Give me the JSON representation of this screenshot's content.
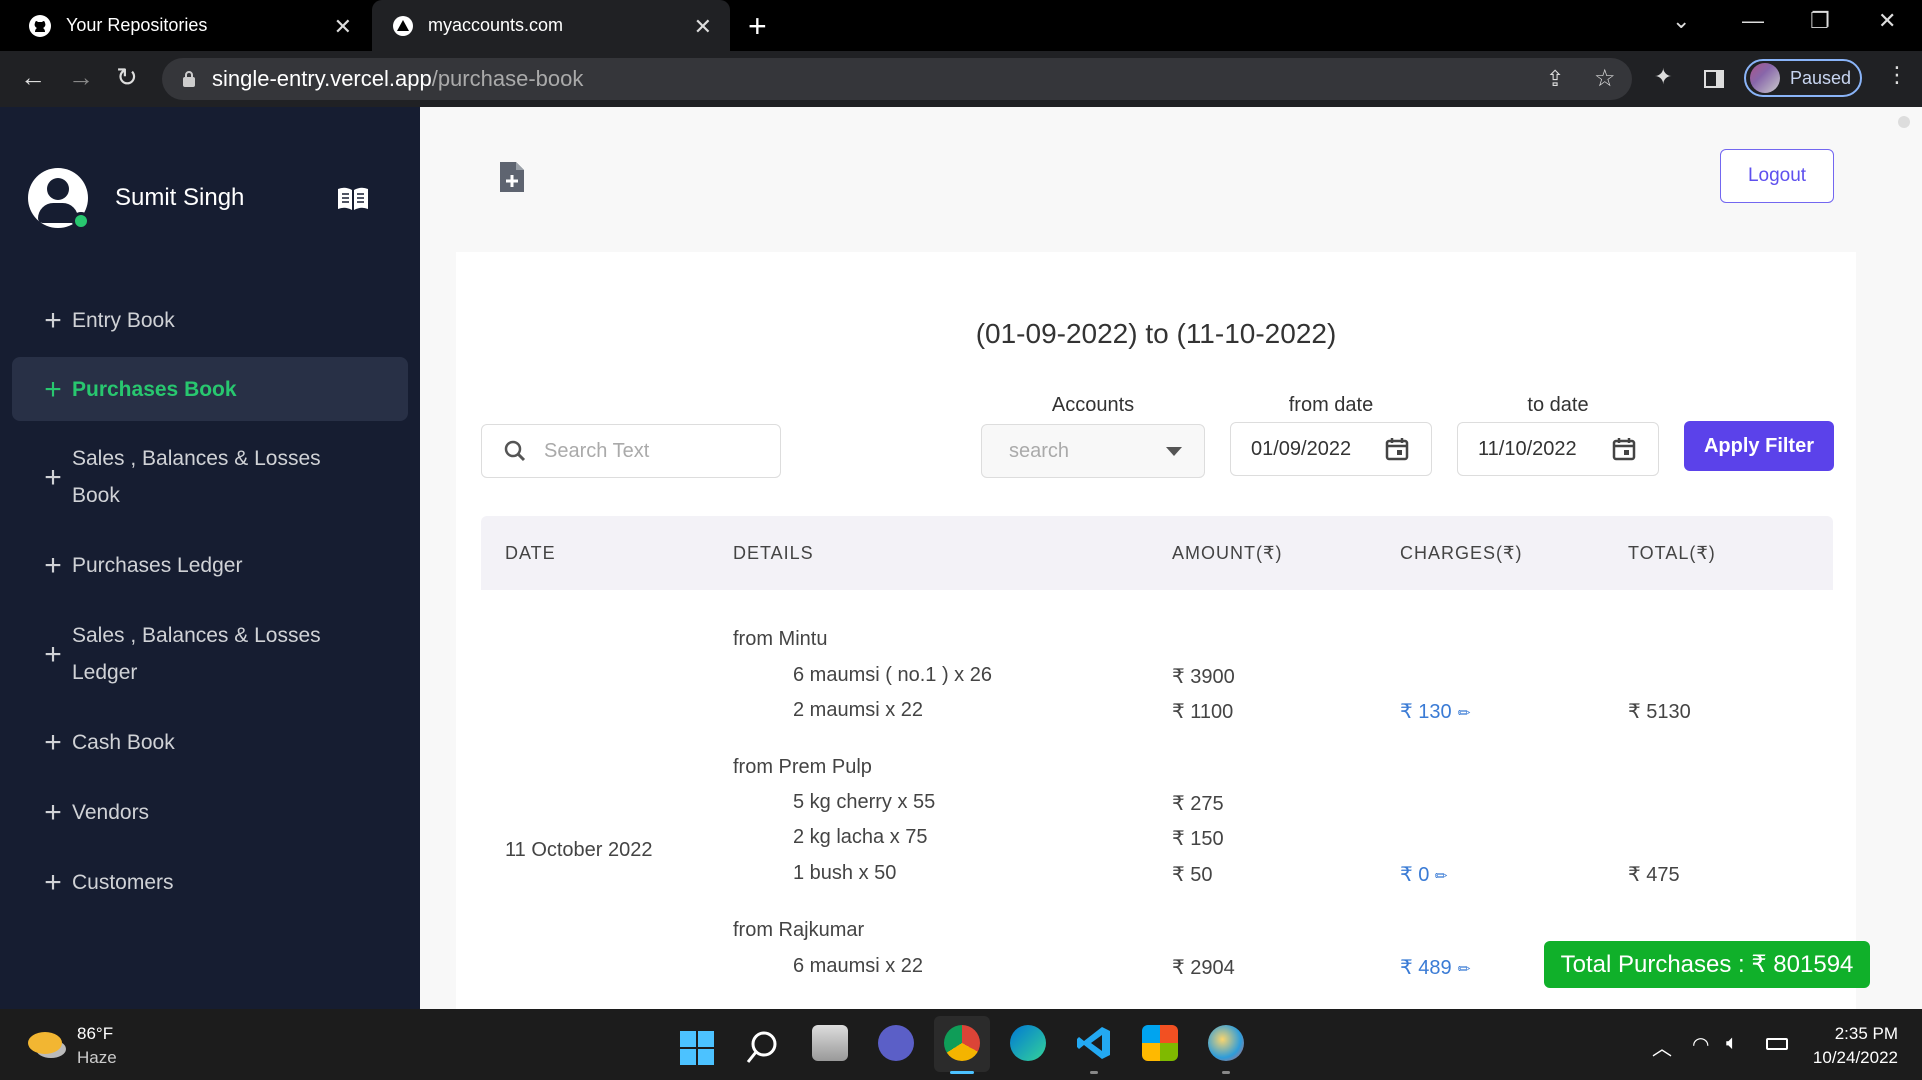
{
  "browser": {
    "tabs": [
      {
        "title": "Your Repositories"
      },
      {
        "title": "myaccounts.com"
      }
    ],
    "url_host": "single-entry.vercel.app",
    "url_path": "/purchase-book",
    "profile_label": "Paused"
  },
  "sidebar": {
    "user_name": "Sumit Singh",
    "items": [
      {
        "label": "Entry Book"
      },
      {
        "label": "Purchases Book",
        "active": true
      },
      {
        "label": "Sales , Balances & Losses Book"
      },
      {
        "label": "Purchases Ledger"
      },
      {
        "label": "Sales , Balances & Losses Ledger"
      },
      {
        "label": "Cash Book"
      },
      {
        "label": "Vendors"
      },
      {
        "label": "Customers"
      }
    ]
  },
  "header": {
    "logout_label": "Logout"
  },
  "filters": {
    "date_range": "(01-09-2022) to (11-10-2022)",
    "search_placeholder": "Search Text",
    "accounts_label": "Accounts",
    "accounts_placeholder": "search",
    "from_label": "from date",
    "from_value": "01/09/2022",
    "to_label": "to date",
    "to_value": "11/10/2022",
    "apply_label": "Apply Filter"
  },
  "table": {
    "columns": [
      "DATE",
      "DETAILS",
      "AMOUNT(₹)",
      "CHARGES(₹)",
      "TOTAL(₹)"
    ],
    "date": "11 October 2022",
    "groups": [
      {
        "vendor": "from Mintu",
        "items": [
          {
            "desc": "6 maumsi ( no.1 ) x 26",
            "amount": "₹ 3900"
          },
          {
            "desc": "2 maumsi x 22",
            "amount": "₹ 1100"
          }
        ],
        "charges": "₹ 130",
        "total": "₹ 5130"
      },
      {
        "vendor": "from Prem Pulp",
        "items": [
          {
            "desc": "5 kg cherry x 55",
            "amount": "₹ 275"
          },
          {
            "desc": "2 kg lacha x 75",
            "amount": "₹ 150"
          },
          {
            "desc": "1 bush x 50",
            "amount": "₹ 50"
          }
        ],
        "charges": "₹ 0",
        "total": "₹ 475"
      },
      {
        "vendor": "from Rajkumar",
        "items": [
          {
            "desc": "6 maumsi x 22",
            "amount": "₹ 2904"
          }
        ],
        "charges": "₹ 489",
        "total": ""
      }
    ]
  },
  "total_purchases": "Total Purchases : ₹ 801594",
  "taskbar": {
    "weather_temp": "86°F",
    "weather_desc": "Haze",
    "time": "2:35 PM",
    "date": "10/24/2022"
  },
  "colors": {
    "sidebar_bg": "#161d31",
    "active_green": "#28c76f",
    "primary": "#5b42ea",
    "link_blue": "#3a7bd5",
    "total_badge": "#10b02a"
  }
}
